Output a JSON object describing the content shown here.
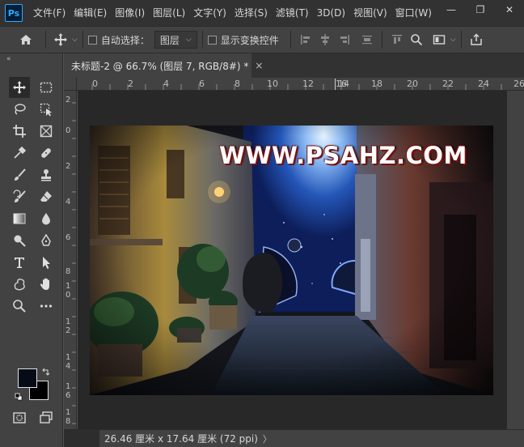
{
  "app": {
    "logo_text": "Ps"
  },
  "menu": {
    "items": [
      "文件(F)",
      "编辑(E)",
      "图像(I)",
      "图层(L)",
      "文字(Y)",
      "选择(S)",
      "滤镜(T)",
      "3D(D)",
      "视图(V)",
      "窗口(W)"
    ]
  },
  "window_controls": {
    "minimize": "—",
    "restore": "❐",
    "close": "✕"
  },
  "options": {
    "auto_select_label": "自动选择：",
    "auto_select_checked": false,
    "target_value": "图层",
    "show_transform_label": "显示变换控件",
    "show_transform_checked": false
  },
  "tools_panel": {
    "collapse_glyph": "«"
  },
  "document": {
    "tab_title": "未标题-2 @ 66.7% (图层 7, RGB/8#) *",
    "tab_close": "×",
    "watermark": "WWW.PSAHZ.COM"
  },
  "ruler_top": {
    "labels": [
      "2",
      "0",
      "2",
      "4",
      "6",
      "8",
      "10",
      "12",
      "14",
      "16",
      "18",
      "20",
      "22",
      "24",
      "26"
    ]
  },
  "ruler_left": {
    "labels": [
      "2",
      "0",
      "2",
      "4",
      "6",
      "8",
      "1\n0",
      "1\n2",
      "1\n4",
      "1\n6",
      "1\n8"
    ]
  },
  "status": {
    "text": "26.46 厘米 x 17.64 厘米 (72 ppi)",
    "arrow": "〉"
  },
  "colors": {
    "foreground": "#050c17",
    "background": "#000000",
    "panel": "#424242",
    "menubar": "#323232",
    "canvas_bg": "#282828",
    "accent": "#31a8ff"
  }
}
